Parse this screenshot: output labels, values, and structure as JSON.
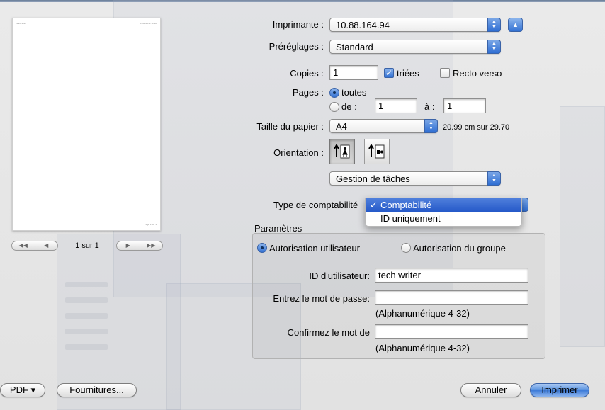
{
  "preview": {
    "header_left": "Sans titre",
    "header_right": "07/08/2012 12:18",
    "footer": "Page 1 sur 1",
    "page_indicator": "1 sur 1"
  },
  "printer": {
    "label": "Imprimante :",
    "value": "10.88.164.94"
  },
  "presets": {
    "label": "Préréglages :",
    "value": "Standard"
  },
  "copies": {
    "label": "Copies :",
    "value": "1",
    "collated_label": "triées",
    "collated": true,
    "duplex_label": "Recto verso",
    "duplex": false
  },
  "pages": {
    "label": "Pages :",
    "all_label": "toutes",
    "from_label": "de :",
    "from_value": "1",
    "to_label": "à :",
    "to_value": "1",
    "selected": "toutes"
  },
  "paper": {
    "label": "Taille du papier :",
    "value": "A4",
    "dimensions": "20.99 cm sur 29.70"
  },
  "orientation": {
    "label": "Orientation :",
    "selected": "portrait"
  },
  "section": {
    "value": "Gestion de tâches"
  },
  "accounting": {
    "label": "Type de comptabilité",
    "menu": [
      {
        "label": "Comptabilité",
        "checked": true,
        "mark": "✓"
      },
      {
        "label": "ID uniquement",
        "checked": false,
        "mark": ""
      }
    ]
  },
  "params": {
    "title": "Paramètres",
    "user_auth_label": "Autorisation utilisateur",
    "group_auth_label": "Autorisation du groupe",
    "selected": "user",
    "user_id_label": "ID d'utilisateur:",
    "user_id_value": "tech writer",
    "password_label": "Entrez le mot de passe:",
    "password_hint": "(Alphanumérique 4-32)",
    "confirm_label": "Confirmez le mot de",
    "confirm_hint": "(Alphanumérique 4-32)"
  },
  "buttons": {
    "pdf": "PDF ▾",
    "supplies": "Fournitures...",
    "cancel": "Annuler",
    "print": "Imprimer"
  }
}
